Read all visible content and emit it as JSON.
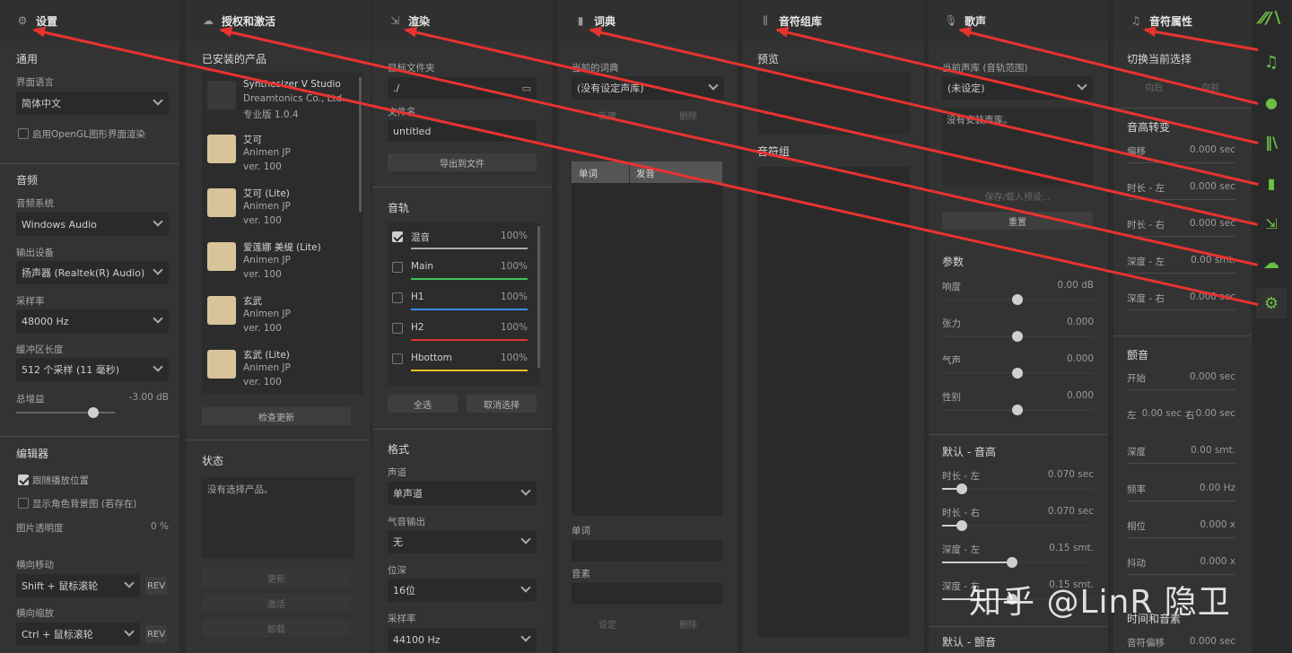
{
  "settings": {
    "title": "设置",
    "general": "通用",
    "ui_language_label": "界面语言",
    "ui_language": "简体中文",
    "opengl_label": "启用OpenGL图形界面渲染",
    "audio": "音频",
    "audio_system_label": "音频系统",
    "audio_system": "Windows Audio",
    "output_label": "输出设备",
    "output": "扬声器 (Realtek(R) Audio)",
    "sample_rate_label": "采样率",
    "sample_rate": "48000 Hz",
    "buffer_label": "缓冲区长度",
    "buffer": "512 个采样 (11 毫秒)",
    "gain_label": "总增益",
    "gain": "-3.00 dB",
    "editor": "编辑器",
    "follow_label": "跟随播放位置",
    "show_bg_label": "显示角色背景图 (若存在)",
    "opacity_label": "图片透明度",
    "opacity": "0 %",
    "hscroll_label": "横向移动",
    "hscroll": "Shift + 鼠标滚轮",
    "hzoom_label": "横向缩放",
    "hzoom": "Ctrl + 鼠标滚轮",
    "rev": "REV"
  },
  "license": {
    "title": "授权和激活",
    "installed": "已安装的产品",
    "products": [
      {
        "name": "Synthesizer V Studio",
        "sub": "Dreamtonics Co., Ltd.",
        "ver": "专业版 1.0.4"
      },
      {
        "name": "艾可",
        "sub": "Animen JP",
        "ver": "ver. 100"
      },
      {
        "name": "艾可 (Lite)",
        "sub": "Animen JP",
        "ver": "ver. 100"
      },
      {
        "name": "爱莲娜 美缇 (Lite)",
        "sub": "Animen JP",
        "ver": "ver. 100"
      },
      {
        "name": "玄武",
        "sub": "Animen JP",
        "ver": "ver. 100"
      },
      {
        "name": "玄武 (Lite)",
        "sub": "Animen JP",
        "ver": "ver. 100"
      }
    ],
    "check_update": "检查更新",
    "status": "状态",
    "status_text": "没有选择产品。",
    "btn_update": "更新",
    "btn_activate": "激活",
    "btn_remove": "卸载"
  },
  "render": {
    "title": "渲染",
    "output_folder": "目标文件夹",
    "folder_value": "./",
    "filename_label": "文件名",
    "filename": "untitled",
    "export": "导出到文件",
    "tracks": "音轨",
    "track_list": [
      {
        "name": "混音",
        "vol": "100%",
        "checked": true,
        "color": "#aaaaaa"
      },
      {
        "name": "Main",
        "vol": "100%",
        "checked": false,
        "color": "#3cc45a"
      },
      {
        "name": "H1",
        "vol": "100%",
        "checked": false,
        "color": "#3a8ee6"
      },
      {
        "name": "H2",
        "vol": "100%",
        "checked": false,
        "color": "#e03030"
      },
      {
        "name": "Hbottom",
        "vol": "100%",
        "checked": false,
        "color": "#e6c020"
      }
    ],
    "select_all": "全选",
    "deselect": "取消选择",
    "format": "格式",
    "channel_label": "声道",
    "channel": "单声道",
    "breath_label": "气音输出",
    "breath": "无",
    "bitdepth_label": "位深",
    "bitdepth": "16位",
    "sr_label": "采样率",
    "sr": "44100 Hz"
  },
  "dictionary": {
    "title": "词典",
    "current_label": "当前的词典",
    "current": "(没有设定声库)",
    "btn_new": "新建",
    "btn_delete": "删除",
    "col_word": "单词",
    "col_pron": "发音",
    "word_label": "单词",
    "phoneme_label": "音素",
    "btn_set": "设定",
    "btn_del": "删除"
  },
  "notegroup": {
    "title": "音符组库",
    "preview": "预览",
    "group": "音符组"
  },
  "voice": {
    "title": "歌声",
    "current_db_label": "当前声库 (音轨范围)",
    "current_db": "(未设定)",
    "no_db": "没有安装声库。",
    "save_load": "保存/载入预设...",
    "reset": "重置",
    "params": "参数",
    "p_loud": "响度",
    "p_loud_v": "0.00 dB",
    "p_tension": "张力",
    "p_tension_v": "0.000",
    "p_breath": "气声",
    "p_breath_v": "0.000",
    "p_gender": "性别",
    "p_gender_v": "0.000",
    "default_pitch": "默认 - 音高",
    "dp_left": "时长 - 左",
    "dp_left_v": "0.070 sec",
    "dp_right": "时长 - 右",
    "dp_right_v": "0.070 sec",
    "dp_depth_l": "深度 - 左",
    "dp_depth_l_v": "0.15 smt.",
    "dp_depth_r": "深度 - 右",
    "dp_depth_r_v": "0.15 smt.",
    "default_vib": "默认 - 颤音"
  },
  "note_props": {
    "title": "音符属性",
    "switch_sel": "切换当前选择",
    "prev": "向后",
    "next": "向前",
    "pitch_trans": "音高转变",
    "offset": "偏移",
    "offset_v": "0.000 sec",
    "dur_l": "时长 - 左",
    "dur_l_v": "0.000 sec",
    "dur_r": "时长 - 右",
    "dur_r_v": "0.000 sec",
    "depth_l": "深度 - 左",
    "depth_l_v": "0.00 smt.",
    "depth_r": "深度 - 右",
    "depth_r_v": "0.000 sec",
    "vibrato": "颤音",
    "start": "开始",
    "start_v": "0.000 sec",
    "left": "左",
    "left_v": "0.00 sec",
    "right": "右",
    "right_v": "0.00 sec",
    "depth": "深度",
    "depth_v": "0.00 smt.",
    "freq": "频率",
    "freq_v": "0.00 Hz",
    "phase": "相位",
    "phase_v": "0.000 x",
    "jitter": "抖动",
    "jitter_v": "0.000 x",
    "timing": "时间和音素",
    "note_offset": "音符偏移",
    "note_offset_v": "0.000 sec"
  },
  "watermark": "知乎 @LinR 隐卫",
  "colors": {
    "accent": "#6abf45",
    "arrow": "#e8332f"
  }
}
